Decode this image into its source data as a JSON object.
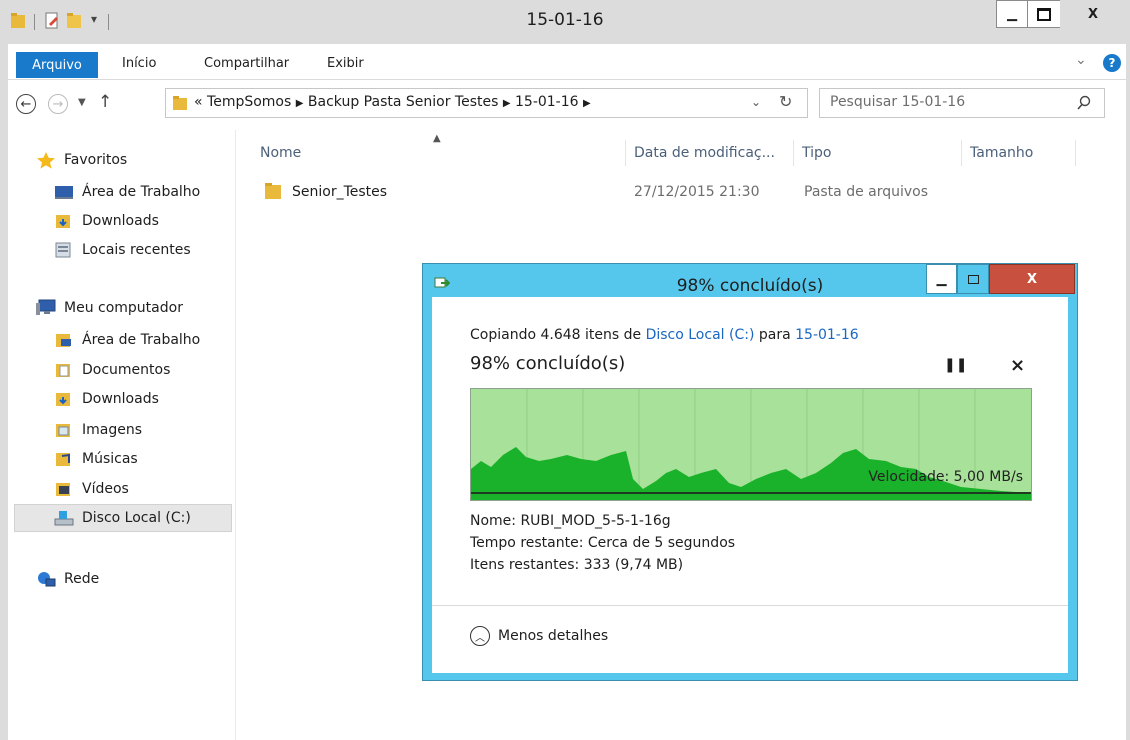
{
  "window": {
    "title": "15-01-16"
  },
  "ribbon": {
    "tabs": [
      "Arquivo",
      "Início",
      "Compartilhar",
      "Exibir"
    ]
  },
  "nav": {
    "address_prefix": "«",
    "address_parts": [
      "TempSomos",
      "Backup Pasta Senior Testes",
      "15-01-16"
    ],
    "search_placeholder": "Pesquisar 15-01-16"
  },
  "sidebar": {
    "favorites": {
      "label": "Favoritos",
      "items": [
        "Área de Trabalho",
        "Downloads",
        "Locais recentes"
      ]
    },
    "computer": {
      "label": "Meu computador",
      "items": [
        "Área de Trabalho",
        "Documentos",
        "Downloads",
        "Imagens",
        "Músicas",
        "Vídeos",
        "Disco Local (C:)"
      ]
    },
    "network": {
      "label": "Rede"
    }
  },
  "file_list": {
    "columns": [
      "Nome",
      "Data de modificaç...",
      "Tipo",
      "Tamanho"
    ],
    "rows": [
      {
        "name": "Senior_Testes",
        "modified": "27/12/2015 21:30",
        "type": "Pasta de arquivos",
        "size": ""
      }
    ]
  },
  "copy_dialog": {
    "title": "98% concluído(s)",
    "copy_prefix": "Copiando 4.648 itens de",
    "source": "Disco Local (C:)",
    "copy_mid": "para",
    "destination": "15-01-16",
    "progress_text": "98% concluído(s)",
    "progress_fraction": 0.98,
    "speed": "Velocidade: 5,00 MB/s",
    "name_line": "Nome:  RUBI_MOD_5-5-1-16g",
    "time_line": "Tempo restante:  Cerca de 5 segundos",
    "items_line": "Itens restantes:  333 (9,74 MB)",
    "less_details": "Menos detalhes"
  },
  "colors": {
    "accent": "#1979ca",
    "dialog_frame": "#56c7ec",
    "graph_bg": "#a8e19a",
    "graph_fill": "#19b22a",
    "close_red": "#c7503e"
  }
}
